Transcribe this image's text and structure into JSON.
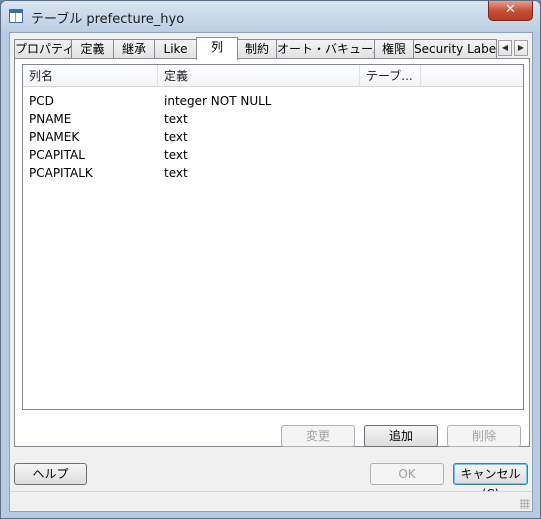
{
  "window": {
    "title": "テーブル prefecture_hyo",
    "close_glyph": "✕"
  },
  "tabs": [
    {
      "label": "プロパティ"
    },
    {
      "label": "定義"
    },
    {
      "label": "継承"
    },
    {
      "label": "Like"
    },
    {
      "label": "列",
      "active": true
    },
    {
      "label": "制約"
    },
    {
      "label": "オート・バキューム"
    },
    {
      "label": "権限"
    },
    {
      "label": "Security Labe"
    }
  ],
  "tab_scroll": {
    "left": "◀",
    "right": "▶"
  },
  "columns_list": {
    "headers": [
      "列名",
      "定義",
      "テーブ..."
    ],
    "rows": [
      {
        "name": "PCD",
        "definition": "integer NOT NULL"
      },
      {
        "name": "PNAME",
        "definition": "text"
      },
      {
        "name": "PNAMEK",
        "definition": "text"
      },
      {
        "name": "PCAPITAL",
        "definition": "text"
      },
      {
        "name": "PCAPITALK",
        "definition": "text"
      }
    ]
  },
  "panel_buttons": {
    "change": "変更",
    "add": "追加",
    "delete": "削除"
  },
  "dialog_buttons": {
    "help": "ヘルプ",
    "ok": "OK",
    "cancel": "キャンセル(C)"
  },
  "colors": {
    "title_bar": "#bccfe3",
    "close_button": "#c7503a",
    "client_bg": "#f0f0f0"
  }
}
